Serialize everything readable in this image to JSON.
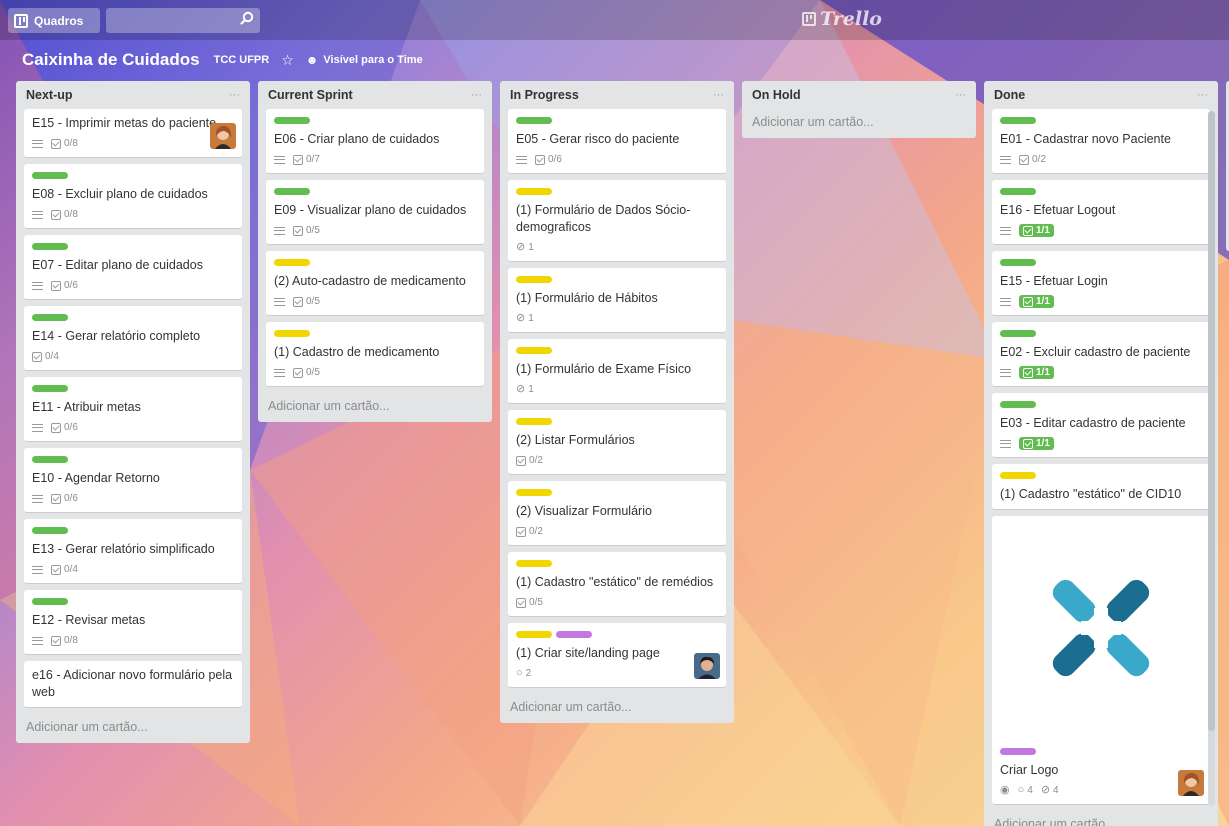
{
  "topbar": {
    "boards_label": "Quadros",
    "logo_text": "Trello"
  },
  "board": {
    "title": "Caixinha de Cuidados",
    "org": "TCC UFPR",
    "visibility": "Visível para o Time"
  },
  "colors": {
    "green": "#61bd4f",
    "yellow": "#f2d600",
    "purple": "#c377e0"
  },
  "lists": [
    {
      "name": "Next-up",
      "menu": "···",
      "add": "Adicionar um cartão...",
      "cards": [
        {
          "title": "E15 - Imprimir metas do paciente",
          "labels": [],
          "desc": true,
          "check": "0/8",
          "avatar": "avatar-woman"
        },
        {
          "title": "E08 - Excluir plano de cuidados",
          "labels": [
            "green"
          ],
          "desc": true,
          "check": "0/8"
        },
        {
          "title": "E07 - Editar plano de cuidados",
          "labels": [
            "green"
          ],
          "desc": true,
          "check": "0/6"
        },
        {
          "title": "E14 - Gerar relatório completo",
          "labels": [
            "green"
          ],
          "desc": false,
          "check": "0/4"
        },
        {
          "title": "E11 - Atribuir metas",
          "labels": [
            "green"
          ],
          "desc": true,
          "check": "0/6"
        },
        {
          "title": "E10 - Agendar Retorno",
          "labels": [
            "green"
          ],
          "desc": true,
          "check": "0/6"
        },
        {
          "title": "E13 - Gerar relatório simplificado",
          "labels": [
            "green"
          ],
          "desc": true,
          "check": "0/4"
        },
        {
          "title": "E12 - Revisar metas",
          "labels": [
            "green"
          ],
          "desc": true,
          "check": "0/8"
        },
        {
          "title": "e16 - Adicionar novo formulário pela web",
          "labels": []
        }
      ]
    },
    {
      "name": "Current Sprint",
      "menu": "···",
      "add": "Adicionar um cartão...",
      "cards": [
        {
          "title": "E06 - Criar plano de cuidados",
          "labels": [
            "green"
          ],
          "desc": true,
          "check": "0/7"
        },
        {
          "title": "E09 - Visualizar plano de cuidados",
          "labels": [
            "green"
          ],
          "desc": true,
          "check": "0/5"
        },
        {
          "title": "(2) Auto-cadastro de medicamento",
          "labels": [
            "yellow"
          ],
          "desc": true,
          "check": "0/5"
        },
        {
          "title": "(1) Cadastro de medicamento",
          "labels": [
            "yellow"
          ],
          "desc": true,
          "check": "0/5"
        }
      ]
    },
    {
      "name": "In Progress",
      "menu": "···",
      "add": "Adicionar um cartão...",
      "cards": [
        {
          "title": "E05 - Gerar risco do paciente",
          "labels": [
            "green"
          ],
          "desc": true,
          "check": "0/6"
        },
        {
          "title": "(1) Formulário de Dados Sócio-demograficos",
          "labels": [
            "yellow"
          ],
          "attach": "1"
        },
        {
          "title": "(1) Formulário de Hábitos",
          "labels": [
            "yellow"
          ],
          "attach": "1"
        },
        {
          "title": "(1) Formulário de Exame Físico",
          "labels": [
            "yellow"
          ],
          "attach": "1"
        },
        {
          "title": "(2) Listar Formulários",
          "labels": [
            "yellow"
          ],
          "check": "0/2"
        },
        {
          "title": "(2) Visualizar Formulário",
          "labels": [
            "yellow"
          ],
          "check": "0/2"
        },
        {
          "title": "(1) Cadastro \"estático\" de remédios",
          "labels": [
            "yellow"
          ],
          "check": "0/5"
        },
        {
          "title": "(1) Criar site/landing page",
          "labels": [
            "yellow",
            "purple"
          ],
          "comments": "2",
          "avatar": "avatar-man"
        }
      ]
    },
    {
      "name": "On Hold",
      "menu": "···",
      "add": "Adicionar um cartão...",
      "cards": []
    },
    {
      "name": "Done",
      "menu": "···",
      "add": "Adicionar um cartão...",
      "cards": [
        {
          "title": "E01 - Cadastrar novo Paciente",
          "labels": [
            "green"
          ],
          "desc": true,
          "check": "0/2"
        },
        {
          "title": "E16 - Efetuar Logout",
          "labels": [
            "green"
          ],
          "desc": true,
          "check": "1/1",
          "complete": true
        },
        {
          "title": "E15 - Efetuar Login",
          "labels": [
            "green"
          ],
          "desc": true,
          "check": "1/1",
          "complete": true
        },
        {
          "title": "E02 - Excluir cadastro de paciente",
          "labels": [
            "green"
          ],
          "desc": true,
          "check": "1/1",
          "complete": true
        },
        {
          "title": "E03 - Editar cadastro de paciente",
          "labels": [
            "green"
          ],
          "desc": true,
          "check": "1/1",
          "complete": true
        },
        {
          "title": "(1) Cadastro \"estático\" de CID10",
          "labels": [
            "yellow"
          ]
        },
        {
          "title": "Criar Logo",
          "labels": [
            "purple"
          ],
          "cover": "hands-cross-logo",
          "watch": true,
          "comments": "4",
          "attach": "4",
          "avatar": "avatar-woman"
        }
      ]
    }
  ]
}
